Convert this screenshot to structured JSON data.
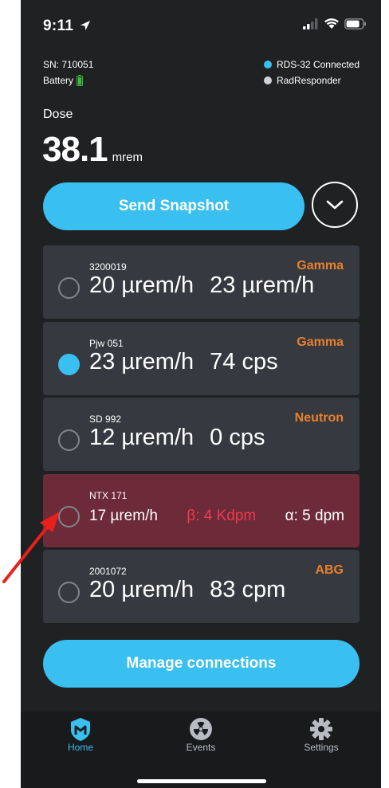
{
  "status_bar": {
    "time": "9:11"
  },
  "device": {
    "serial": "SN: 710051",
    "battery_label": "Battery"
  },
  "connections": [
    {
      "label": "RDS-32 Connected",
      "color": "#39bff0"
    },
    {
      "label": "RadResponder",
      "color": "#cfd2d6"
    }
  ],
  "dose": {
    "label": "Dose",
    "value": "38.1",
    "unit": "mrem"
  },
  "actions": {
    "send_snapshot": "Send Snapshot",
    "manage_connections": "Manage connections"
  },
  "detectors": [
    {
      "name": "3200019",
      "type": "Gamma",
      "primary": "20 µrem/h",
      "secondary": "23 µrem/h",
      "selected": false
    },
    {
      "name": "Pjw 051",
      "type": "Gamma",
      "primary": "23 µrem/h",
      "secondary": "74 cps",
      "selected": true
    },
    {
      "name": "SD 992",
      "type": "Neutron",
      "primary": "12 µrem/h",
      "secondary": "0 cps",
      "selected": false
    },
    {
      "name": "NTX 171",
      "type": "",
      "primary": "17 µrem/h",
      "beta": "β: 4 Kdpm",
      "alpha": "α: 5 dpm",
      "selected": false,
      "alert": true
    },
    {
      "name": "2001072",
      "type": "ABG",
      "primary": "20 µrem/h",
      "secondary": "83 cpm",
      "selected": false
    }
  ],
  "tabs": [
    {
      "label": "Home",
      "icon": "home-shield-icon",
      "active": true
    },
    {
      "label": "Events",
      "icon": "radiation-icon",
      "active": false
    },
    {
      "label": "Settings",
      "icon": "gear-icon",
      "active": false
    }
  ],
  "colors": {
    "accent": "#39bff0",
    "type_label": "#e8802a",
    "alert_bg": "#6d2a38",
    "beta": "#ee3a52",
    "annotation_arrow": "#e8201c"
  }
}
